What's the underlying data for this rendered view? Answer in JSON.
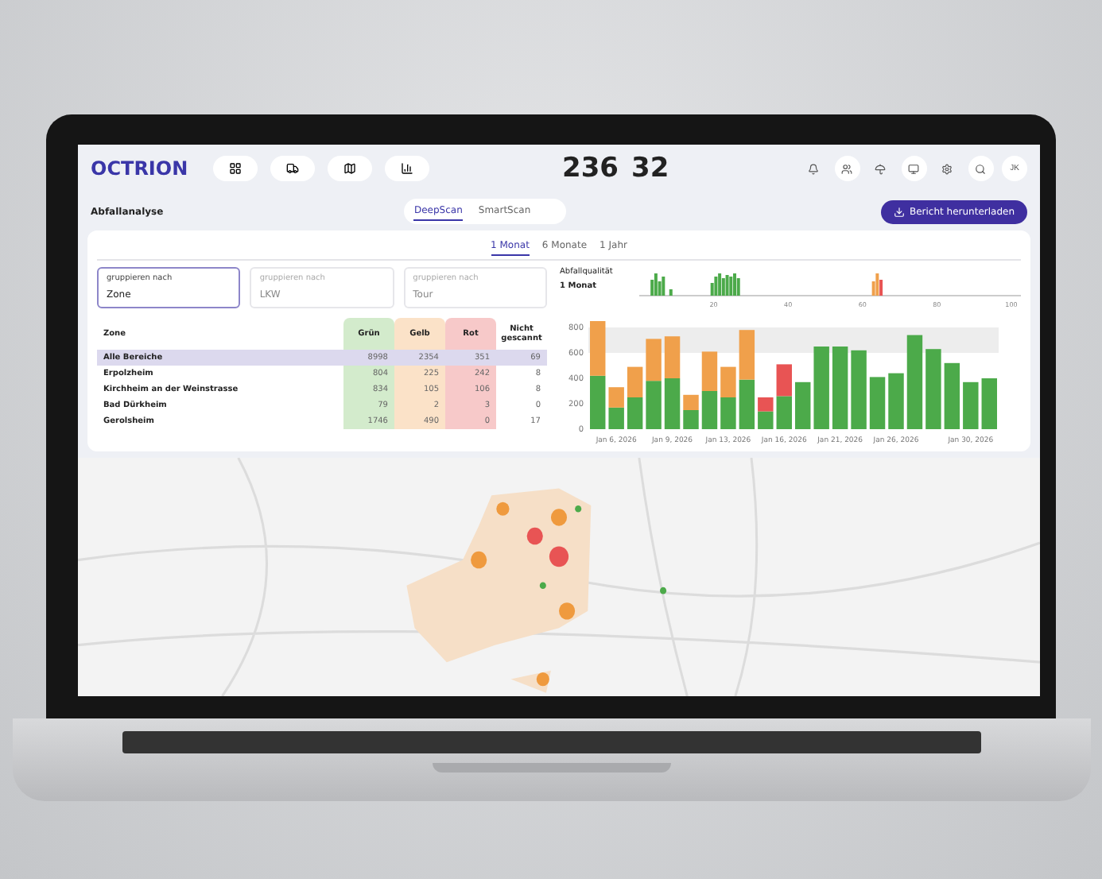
{
  "header": {
    "logo": "OCTRION",
    "stats": [
      "236",
      "32"
    ],
    "avatar": "JK"
  },
  "page": {
    "title": "Abfallanalyse",
    "modes": [
      {
        "label": "DeepScan",
        "selected": true
      },
      {
        "label": "SmartScan",
        "selected": false
      }
    ],
    "download": "Bericht herunterladen"
  },
  "periods": [
    {
      "label": "1 Monat",
      "selected": true
    },
    {
      "label": "6 Monate",
      "selected": false
    },
    {
      "label": "1 Jahr",
      "selected": false
    }
  ],
  "groupings": [
    {
      "label": "gruppieren nach",
      "value": "Zone",
      "selected": true
    },
    {
      "label": "gruppieren nach",
      "value": "LKW",
      "selected": false
    },
    {
      "label": "gruppieren nach",
      "value": "Tour",
      "selected": false
    }
  ],
  "table": {
    "columns": [
      {
        "label": "Zone",
        "color": "#ffffff"
      },
      {
        "label": "Grün",
        "color": "#d3ebcc"
      },
      {
        "label": "Gelb",
        "color": "#fbe2c8"
      },
      {
        "label": "Rot",
        "color": "#f7c9c9"
      },
      {
        "label": "Nicht gescannt",
        "color": "#ffffff"
      }
    ],
    "rows": [
      {
        "selected": true,
        "cells": [
          "Alle Bereiche",
          "8998",
          "2354",
          "351",
          "69"
        ]
      },
      {
        "selected": false,
        "cells": [
          "Erpolzheim",
          "804",
          "225",
          "242",
          "8"
        ]
      },
      {
        "selected": false,
        "cells": [
          "Kirchheim an der Weinstrasse",
          "834",
          "105",
          "106",
          "8"
        ]
      },
      {
        "selected": false,
        "cells": [
          "Bad Dürkheim",
          "79",
          "2",
          "3",
          "0"
        ]
      },
      {
        "selected": false,
        "cells": [
          "Gerolsheim",
          "1746",
          "490",
          "0",
          "17"
        ]
      }
    ]
  },
  "quality": {
    "title": "Abfallqualität",
    "period": "1 Monat",
    "ticks": [
      "20",
      "40",
      "60",
      "80",
      "100"
    ]
  },
  "chart_data": {
    "type": "bar",
    "stacked": true,
    "categories": [
      null,
      "Jan 6, 2026",
      null,
      null,
      "Jan 9, 2026",
      null,
      null,
      "Jan 13, 2026",
      null,
      null,
      "Jan 16, 2026",
      null,
      null,
      "Jan 21, 2026",
      null,
      null,
      "Jan 26, 2026",
      null,
      null,
      null,
      "Jan 30, 2026",
      null
    ],
    "series": [
      {
        "color": "#4caa4a",
        "values": [
          420,
          170,
          250,
          380,
          400,
          150,
          300,
          250,
          390,
          140,
          260,
          370,
          650,
          650,
          620,
          410,
          440,
          740,
          630,
          520,
          370,
          400
        ]
      },
      {
        "color": "#f0a04b",
        "values": [
          430,
          160,
          240,
          330,
          330,
          120,
          310,
          240,
          390,
          0,
          0,
          0,
          0,
          0,
          0,
          0,
          0,
          0,
          0,
          0,
          0,
          0
        ]
      },
      {
        "color": "#e85454",
        "values": [
          0,
          0,
          0,
          0,
          0,
          0,
          0,
          0,
          0,
          110,
          250,
          0,
          0,
          0,
          0,
          0,
          0,
          0,
          0,
          0,
          0,
          0
        ]
      }
    ],
    "ylim": [
      0,
      850
    ],
    "yticks": [
      0,
      200,
      400,
      600,
      800
    ]
  }
}
